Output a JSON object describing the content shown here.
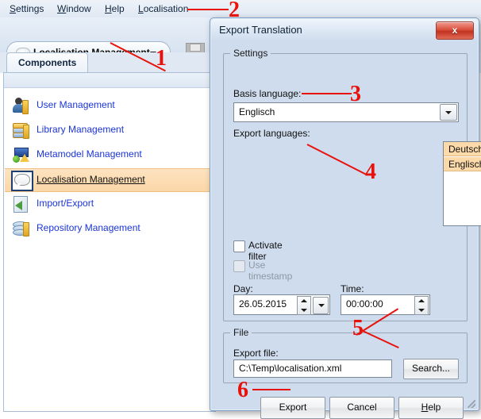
{
  "app": {
    "menubar": [
      {
        "label": "Settings",
        "accel": "S"
      },
      {
        "label": "Window",
        "accel": "W"
      },
      {
        "label": "Help",
        "accel": "H"
      },
      {
        "label": "Localisation",
        "accel": "L"
      }
    ],
    "toolbar": {
      "module_selector_label": "Localisation Management",
      "module_selector_icon": "speech-bubble-icon",
      "save_icon": "floppy-disk-save-icon"
    },
    "tabs": [
      {
        "label": "Components",
        "active": true
      }
    ],
    "nav_items": [
      {
        "label": "User Management",
        "icon": "user-management-icon",
        "selected": false
      },
      {
        "label": "Library Management",
        "icon": "library-management-icon",
        "selected": false
      },
      {
        "label": "Metamodel Management",
        "icon": "metamodel-management-icon",
        "selected": false
      },
      {
        "label": "Localisation Management",
        "icon": "localisation-management-icon",
        "selected": true
      },
      {
        "label": "Import/Export",
        "icon": "import-export-icon",
        "selected": false
      },
      {
        "label": "Repository Management",
        "icon": "repository-management-icon",
        "selected": false
      }
    ]
  },
  "dialog": {
    "title": "Export Translation",
    "close_label": "x",
    "settings_group": {
      "title": "Settings",
      "basis_language_label": "Basis language:",
      "basis_language_value": "Englisch",
      "export_languages_label": "Export languages:",
      "export_languages": [
        {
          "label": "Deutsch",
          "selected": true
        },
        {
          "label": "Englisch",
          "selected": true
        }
      ],
      "activate_filter_label": "Activate filter",
      "activate_filter_checked": false,
      "use_timestamp_label": "Use timestamp",
      "use_timestamp_checked": false,
      "use_timestamp_disabled": true,
      "day_label": "Day:",
      "day_value": "26.05.2015",
      "time_label": "Time:",
      "time_value": "00:00:00"
    },
    "file_group": {
      "title": "File",
      "export_file_label": "Export file:",
      "export_file_value": "C:\\Temp\\localisation.xml",
      "search_button": "Search..."
    },
    "buttons": {
      "export": "Export",
      "cancel": "Cancel",
      "help": "Help"
    }
  },
  "annotations": {
    "one": "1",
    "two": "2",
    "three": "3",
    "four": "4",
    "five": "5",
    "six": "6",
    "color": "#e8120c"
  }
}
